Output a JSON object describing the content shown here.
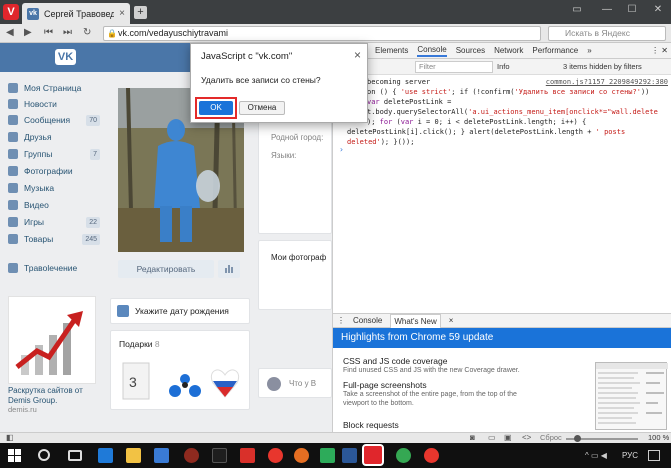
{
  "browser": {
    "tab_title": "Сергей Травовед",
    "url": "vk.com/vedayuschiytravami",
    "search_placeholder": "Искать в Яндекс",
    "zoom_label": "Сброс",
    "zoom_value": "100 %"
  },
  "sidebar": {
    "items": [
      {
        "label": "Моя Страница",
        "count": ""
      },
      {
        "label": "Новости",
        "count": ""
      },
      {
        "label": "Сообщения",
        "count": "70"
      },
      {
        "label": "Друзья",
        "count": ""
      },
      {
        "label": "Группы",
        "count": "7"
      },
      {
        "label": "Фотографии",
        "count": ""
      },
      {
        "label": "Музыка",
        "count": ""
      },
      {
        "label": "Видео",
        "count": ""
      },
      {
        "label": "Игры",
        "count": "22"
      },
      {
        "label": "Товары",
        "count": "245"
      },
      {
        "label": "Травоleчение",
        "count": ""
      }
    ],
    "ad_title": "Раскрутка сайтов от Demis Group.",
    "ad_domain": "demis.ru"
  },
  "profile": {
    "edit_button": "Редактировать",
    "birthday_prompt": "Укажите дату рождения",
    "gifts_label": "Подарки",
    "gifts_count": "8",
    "home_town": "Родной город:",
    "languages": "Языки:",
    "my_photos": "Мои фотограф",
    "what_new": "Что у В"
  },
  "devtools": {
    "tabs": [
      "Elements",
      "Console",
      "Sources",
      "Network",
      "Performance"
    ],
    "active_tab": "Console",
    "filter_placeholder": "Filter",
    "level": "Info",
    "hidden": "3 items hidden by filters",
    "source_link": "common.js?1157_2209849292:380",
    "drawer_tabs": [
      "Console",
      "What's New"
    ],
    "highlights_title": "Highlights from Chrome 59 update",
    "sections": [
      {
        "title": "CSS and JS code coverage",
        "desc": "Find unused CSS and JS with the new Coverage drawer."
      },
      {
        "title": "Full-page screenshots",
        "desc": "Take a screenshot of the entire page, from the top of the viewport to the bottom."
      },
      {
        "title": "Block requests",
        "desc": ""
      }
    ]
  },
  "dialog": {
    "title": "JavaScript с \"vk.com\"",
    "message": "Удалить все записи со стены?",
    "ok": "OK",
    "cancel": "Отмена"
  },
  "taskbar": {
    "lang": "РУС"
  },
  "colors": {
    "vk_blue": "#4a76a8",
    "devtools_blue": "#1a73d9",
    "highlight_red": "#e32a2a"
  }
}
